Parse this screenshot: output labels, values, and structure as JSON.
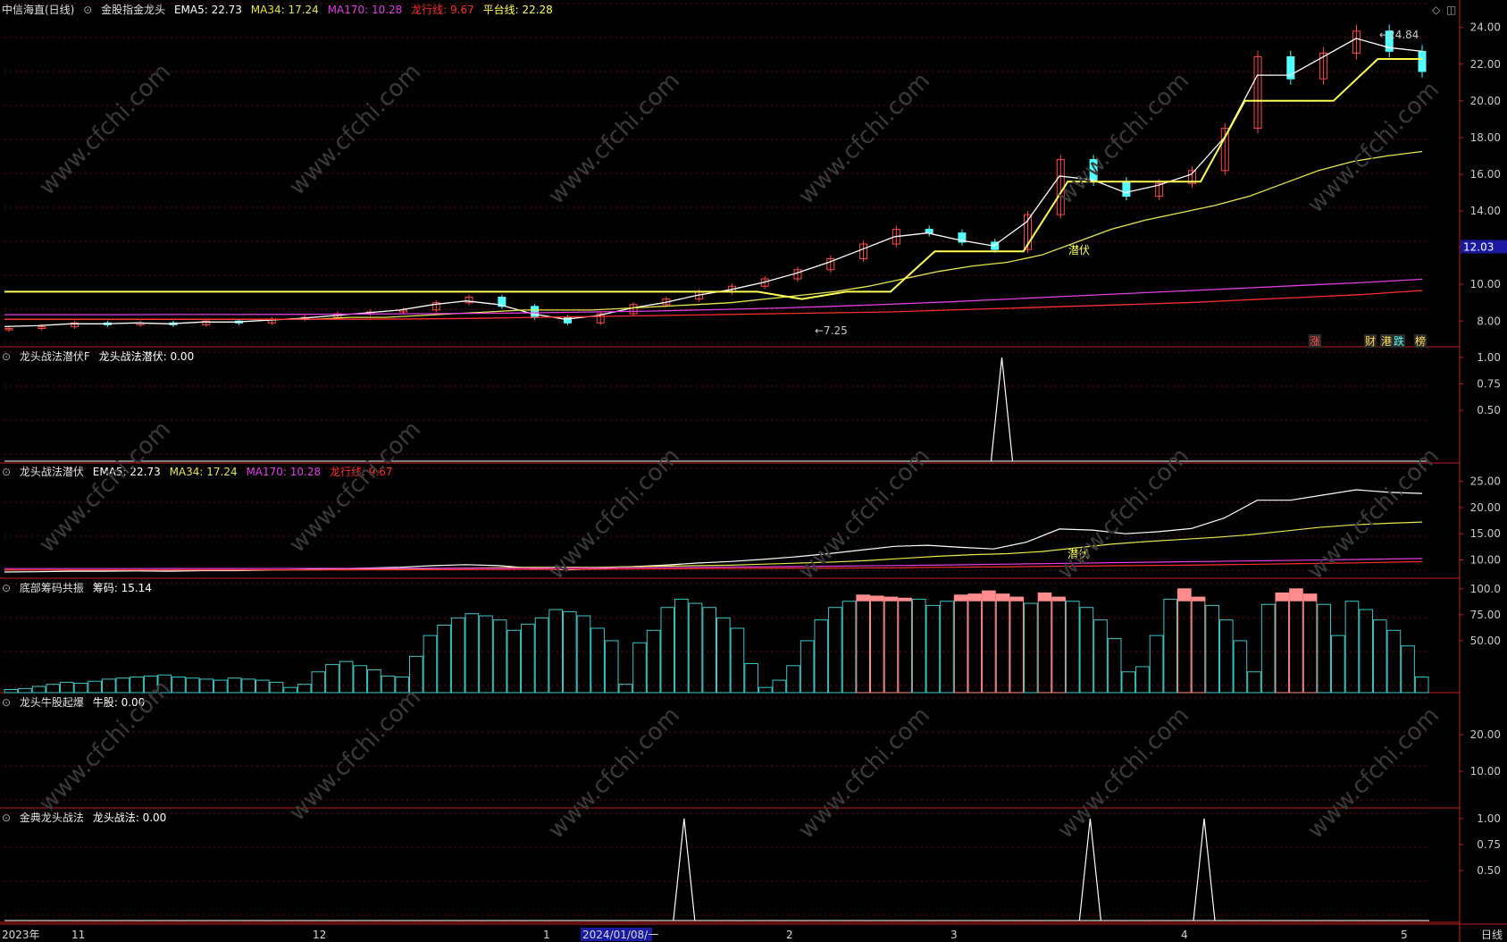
{
  "panel1_header": {
    "title": "中信海直(日线)",
    "indicator": "金股指金龙头",
    "ema5": "EMA5: 22.73",
    "ma34": "MA34: 17.24",
    "ma170": "MA170: 10.28",
    "longxing": "龙行线: 9.67",
    "pingtai": "平台线: 22.28"
  },
  "panel2_header": {
    "name": "龙头战法潜伏F",
    "value": "龙头战法潜伏: 0.00"
  },
  "panel3_header": {
    "name": "龙头战法潜伏",
    "ema5": "EMA5: 22.73",
    "ma34": "MA34: 17.24",
    "ma170": "MA170: 10.28",
    "longxing": "龙行线: 9.67"
  },
  "panel4_header": {
    "name": "底部筹码共振",
    "value": "筹码: 15.14"
  },
  "panel5_header": {
    "name": "龙头牛股起爆",
    "value": "牛股: 0.00"
  },
  "panel6_header": {
    "name": "金典龙头战法",
    "value": "龙头战法: 0.00"
  },
  "colors": {
    "up": "#ff4a4a",
    "down": "#54ffff",
    "ema5": "#ffffff",
    "ma34": "#e6e64a",
    "ma170": "#e23ee2",
    "longxing": "#ff2d2d",
    "pingtai": "#ffff55",
    "axis": "#c81e1e",
    "text": "#c8c8c8"
  },
  "chart_data": [
    {
      "panel": "main",
      "type": "line",
      "ytick_labels": [
        "24.00",
        "22.00",
        "20.00",
        "18.00",
        "16.00",
        "14.00",
        "12.00",
        "10.00",
        "8.00"
      ],
      "ylim": [
        6.6,
        25.3
      ],
      "current_price_label": "12.03",
      "high_label": "24.84",
      "low_label": "7.25",
      "annotation": "潜伏",
      "badges": [
        "涨",
        "财",
        "港",
        "跌",
        "榜"
      ],
      "closes_sampled": [
        7.6,
        7.7,
        7.9,
        7.8,
        7.9,
        7.8,
        8.0,
        7.9,
        8.1,
        8.2,
        8.4,
        8.5,
        8.6,
        9.0,
        9.3,
        8.8,
        8.2,
        7.9,
        8.4,
        8.9,
        9.2,
        9.6,
        9.9,
        10.3,
        10.8,
        11.4,
        12.2,
        13.0,
        12.8,
        12.3,
        11.9,
        13.8,
        16.8,
        15.6,
        14.8,
        15.5,
        16.2,
        18.5,
        22.4,
        21.2,
        22.6,
        23.8,
        22.7,
        21.6
      ],
      "series": [
        {
          "name": "EMA5",
          "values": [
            7.7,
            7.75,
            7.85,
            7.85,
            7.9,
            7.85,
            7.95,
            7.95,
            8.05,
            8.15,
            8.3,
            8.45,
            8.6,
            8.9,
            9.1,
            8.9,
            8.4,
            8.1,
            8.3,
            8.7,
            9.0,
            9.4,
            9.7,
            10.1,
            10.6,
            11.2,
            11.9,
            12.6,
            12.8,
            12.4,
            12.1,
            13.4,
            15.9,
            15.7,
            15.0,
            15.4,
            16.0,
            18.0,
            21.4,
            21.4,
            22.4,
            23.4,
            22.9,
            22.7
          ]
        },
        {
          "name": "MA34",
          "values": [
            8.1,
            8.1,
            8.1,
            8.1,
            8.1,
            8.1,
            8.1,
            8.1,
            8.1,
            8.1,
            8.2,
            8.2,
            8.3,
            8.4,
            8.5,
            8.6,
            8.6,
            8.6,
            8.7,
            8.8,
            8.9,
            9.0,
            9.2,
            9.4,
            9.6,
            9.9,
            10.3,
            10.7,
            11.0,
            11.2,
            11.6,
            12.3,
            13.0,
            13.5,
            13.9,
            14.3,
            14.8,
            15.5,
            16.2,
            16.7,
            17.0,
            17.24
          ]
        },
        {
          "name": "MA170",
          "values": [
            8.35,
            8.35,
            8.35,
            8.36,
            8.36,
            8.37,
            8.38,
            8.4,
            8.42,
            8.45,
            8.5,
            8.55,
            8.62,
            8.7,
            8.8,
            8.92,
            9.05,
            9.2,
            9.35,
            9.5,
            9.65,
            9.8,
            9.95,
            10.1,
            10.28
          ]
        },
        {
          "name": "龙行线",
          "values": [
            8.1,
            8.1,
            8.1,
            8.1,
            8.1,
            8.1,
            8.1,
            8.12,
            8.15,
            8.2,
            8.25,
            8.3,
            8.35,
            8.4,
            8.45,
            8.5,
            8.6,
            8.7,
            8.8,
            8.9,
            9.0,
            9.15,
            9.3,
            9.45,
            9.67
          ]
        },
        {
          "name": "平台线",
          "values": [
            9.6,
            9.6,
            9.6,
            9.6,
            9.6,
            9.6,
            9.6,
            9.6,
            9.6,
            9.6,
            9.6,
            9.6,
            9.6,
            9.6,
            9.6,
            9.6,
            9.6,
            9.6,
            9.2,
            9.6,
            9.6,
            11.8,
            11.8,
            11.8,
            15.6,
            15.6,
            15.6,
            15.6,
            20.0,
            20.0,
            20.0,
            22.28,
            22.28
          ]
        }
      ]
    },
    {
      "panel": "龙头战法潜伏F",
      "type": "line",
      "ytick_labels": [
        "1.00",
        "0.75",
        "0.50"
      ],
      "ylim": [
        0,
        1.05
      ],
      "peaks": [
        0.7
      ]
    },
    {
      "panel": "龙头战法潜伏",
      "type": "line",
      "ytick_labels": [
        "25.00",
        "20.00",
        "15.00",
        "10.00"
      ],
      "ylim": [
        6.5,
        27.5
      ],
      "annotation": "潜伏"
    },
    {
      "panel": "底部筹码共振",
      "type": "bar",
      "ytick_labels": [
        "100.0",
        "75.00",
        "50.00"
      ],
      "ylim": [
        0,
        105
      ],
      "values": [
        3,
        4,
        6,
        8,
        10,
        9,
        11,
        13,
        14,
        15,
        16,
        17,
        15,
        14,
        13,
        12,
        14,
        13,
        12,
        10,
        5,
        8,
        20,
        27,
        30,
        26,
        22,
        16,
        15,
        35,
        55,
        65,
        72,
        76,
        74,
        70,
        60,
        66,
        72,
        80,
        78,
        74,
        62,
        50,
        8,
        48,
        60,
        82,
        90,
        86,
        82,
        72,
        62,
        28,
        5,
        12,
        26,
        50,
        70,
        82,
        88,
        94,
        93,
        92,
        91,
        90,
        84,
        88,
        94,
        95,
        98,
        95,
        92,
        86,
        96,
        92,
        88,
        82,
        70,
        52,
        20,
        25,
        55,
        90,
        100,
        92,
        84,
        70,
        50,
        20,
        85,
        96,
        100,
        95,
        85,
        55,
        88,
        80,
        70,
        60,
        45,
        15
      ]
    },
    {
      "panel": "龙头牛股起爆",
      "type": "line",
      "ytick_labels": [
        "20.00",
        "10.00"
      ],
      "ylim": [
        0,
        30
      ]
    },
    {
      "panel": "金典龙头战法",
      "type": "line",
      "ytick_labels": [
        "1.00",
        "0.75",
        "0.50"
      ],
      "ylim": [
        0,
        1.05
      ],
      "peaks": [
        0.477,
        0.762,
        0.842
      ]
    }
  ],
  "x_axis": {
    "labels": [
      "2023年",
      "11",
      "12",
      "1",
      "2024/01/08/一",
      "2",
      "3",
      "4",
      "5"
    ],
    "period": "日线"
  },
  "tools": {
    "diamond": "◇",
    "window": "◫"
  },
  "watermark": "www.cfchi.com"
}
